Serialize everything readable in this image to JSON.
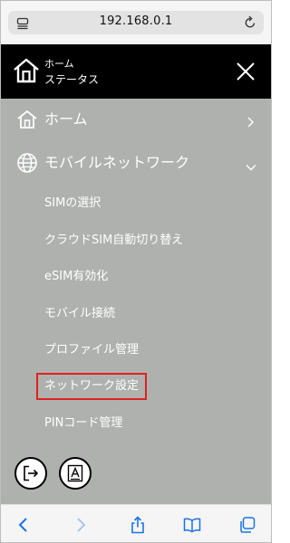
{
  "browser": {
    "url": "192.168.0.1",
    "icons": {
      "page_menu": "page-menu-icon",
      "reload": "reload-icon"
    }
  },
  "header": {
    "title": "ホーム",
    "subtitle": "ステータス",
    "icons": {
      "logo": "home-logo-icon",
      "close": "close-icon"
    }
  },
  "menu": {
    "items": [
      {
        "label": "ホーム",
        "icon": "home-icon",
        "indicator": "chevron-right-icon"
      },
      {
        "label": "モバイルネットワーク",
        "icon": "globe-icon",
        "indicator": "chevron-down-icon"
      }
    ],
    "submenu": [
      {
        "label": "SIMの選択"
      },
      {
        "label": "クラウドSIM自動切り替え"
      },
      {
        "label": "eSIM有効化"
      },
      {
        "label": "モバイル接続"
      },
      {
        "label": "プロファイル管理"
      },
      {
        "label": "ネットワーク設定",
        "highlighted": true
      },
      {
        "label": "PINコード管理"
      }
    ],
    "highlight_color": "#e02020",
    "panel_color": "#aeb1ae"
  },
  "actions": [
    {
      "icon": "logout-icon"
    },
    {
      "icon": "font-size-icon"
    }
  ],
  "toolbar": {
    "icons": [
      "back-icon",
      "forward-icon",
      "share-icon",
      "bookmarks-icon",
      "tabs-icon"
    ],
    "accent_color": "#1a73e8"
  }
}
